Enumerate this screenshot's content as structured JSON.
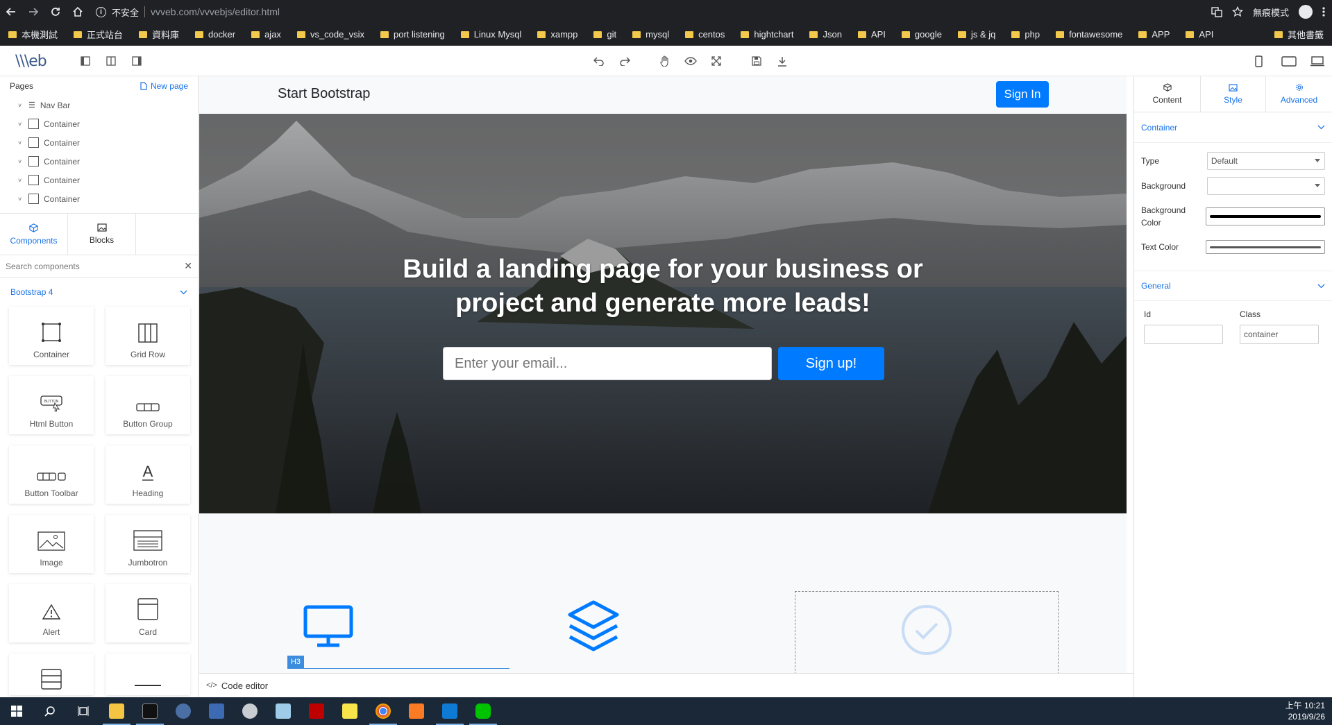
{
  "browser": {
    "insecure_label": "不安全",
    "url_host": "vvveb.com",
    "url_path": "/vvvebjs/editor.html",
    "incognito_label": "無痕模式"
  },
  "bookmarks": [
    "本機測試",
    "正式站台",
    "資料庫",
    "docker",
    "ajax",
    "vs_code_vsix",
    "port listening",
    "Linux Mysql",
    "xampp",
    "git",
    "mysql",
    "centos",
    "hightchart",
    "Json",
    "API",
    "google",
    "js & jq",
    "php",
    "fontawesome",
    "APP",
    "API"
  ],
  "bookmarks_other": "其他書籤",
  "editor": {
    "logo": "\\\\\\eb"
  },
  "left": {
    "pages_label": "Pages",
    "new_page_label": "New page",
    "tree": [
      "Nav Bar",
      "Container",
      "Container",
      "Container",
      "Container",
      "Container"
    ],
    "tabs": [
      {
        "label": "Components",
        "icon": "cube-icon"
      },
      {
        "label": "Blocks",
        "icon": "image-icon"
      }
    ],
    "search_placeholder": "Search components",
    "group_label": "Bootstrap 4",
    "components": [
      "Container",
      "Grid Row",
      "Html Button",
      "Button Group",
      "Button Toolbar",
      "Heading",
      "Image",
      "Jumbotron",
      "Alert",
      "Card"
    ]
  },
  "canvas": {
    "brand": "Start Bootstrap",
    "signin_label": "Sign In",
    "hero_line1": "Build a landing page for your business or",
    "hero_line2": "project and generate more leads!",
    "email_placeholder": "Enter your email...",
    "signup_label": "Sign up!",
    "h3_tag": "H3"
  },
  "code_editor_label": "Code editor",
  "right": {
    "tabs": [
      {
        "label": "Content",
        "icon": "cube-icon"
      },
      {
        "label": "Style",
        "icon": "image-icon"
      },
      {
        "label": "Advanced",
        "icon": "gear-icon"
      }
    ],
    "container_section": "Container",
    "type_label": "Type",
    "type_value": "Default",
    "background_label": "Background",
    "background_value": "",
    "bg_color_label": "Background Color",
    "text_color_label": "Text Color",
    "general_section": "General",
    "id_label": "Id",
    "id_value": "",
    "class_label": "Class",
    "class_value": "container"
  },
  "taskbar": {
    "time": "上午 10:21",
    "date": "2019/9/26"
  },
  "colors": {
    "accent": "#1a73e8",
    "primary_button": "#007bff",
    "browser_bg": "#202124",
    "taskbar_bg": "#1b2838"
  }
}
